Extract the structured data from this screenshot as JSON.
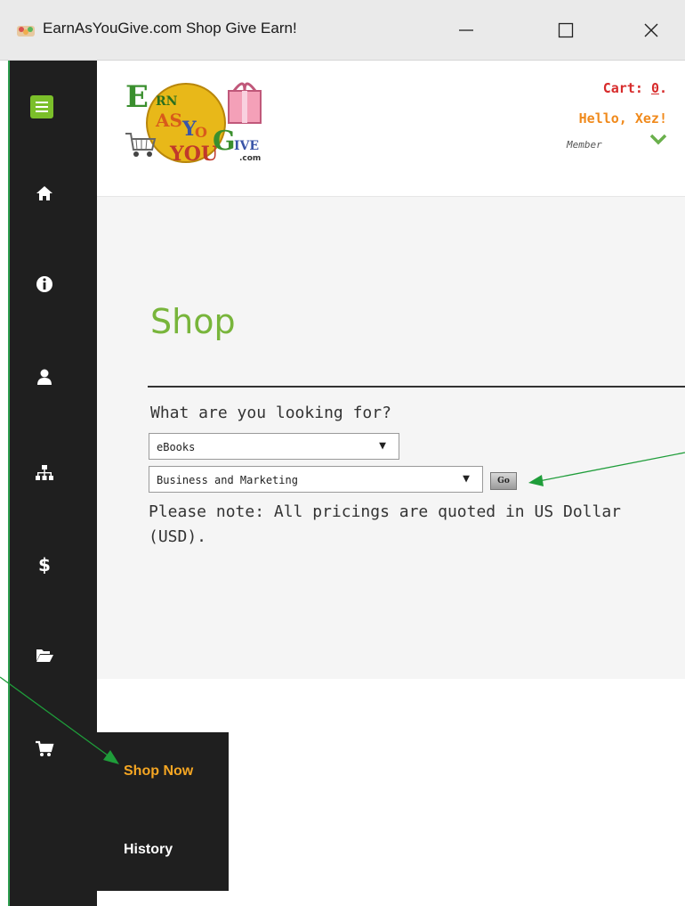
{
  "window": {
    "title": "EarnAsYouGive.com Shop Give Earn!",
    "controls": [
      "minimize-icon",
      "maximize-icon",
      "close-icon"
    ]
  },
  "sidebar": {
    "menu_icon": "hamburger-icon",
    "items": [
      {
        "icon": "home-icon"
      },
      {
        "icon": "info-icon"
      },
      {
        "icon": "user-icon"
      },
      {
        "icon": "sitemap-icon"
      },
      {
        "icon": "dollar-icon"
      },
      {
        "icon": "folder-open-icon"
      },
      {
        "icon": "cart-icon"
      }
    ],
    "submenu": {
      "items": [
        {
          "label": "Shop Now",
          "active": true
        },
        {
          "label": "History",
          "active": false
        }
      ]
    }
  },
  "header": {
    "logo": {
      "brand": "EarnAsYouGive.com",
      "text_parts": [
        "EARN",
        "AS",
        "YOU",
        "GIVE",
        ".com"
      ]
    },
    "cart_label": "Cart: ",
    "cart_count": "0",
    "cart_suffix": ".",
    "greeting": "Hello, Xez!",
    "role": "Member"
  },
  "main": {
    "title": "Shop",
    "question": "What are you looking for?",
    "category_select": {
      "value": "eBooks"
    },
    "subcategory_select": {
      "value": "Business and Marketing"
    },
    "go_label": "Go",
    "note": "Please note: All pricings are quoted in US Dollar (USD)."
  },
  "colors": {
    "sidebar_bg": "#1f1f1f",
    "accent_green": "#78b53b",
    "cart_red": "#d72b2b",
    "hello_orange": "#f08a1c",
    "active_submenu": "#f5a623",
    "annotation_arrow": "#1f9d3a"
  }
}
